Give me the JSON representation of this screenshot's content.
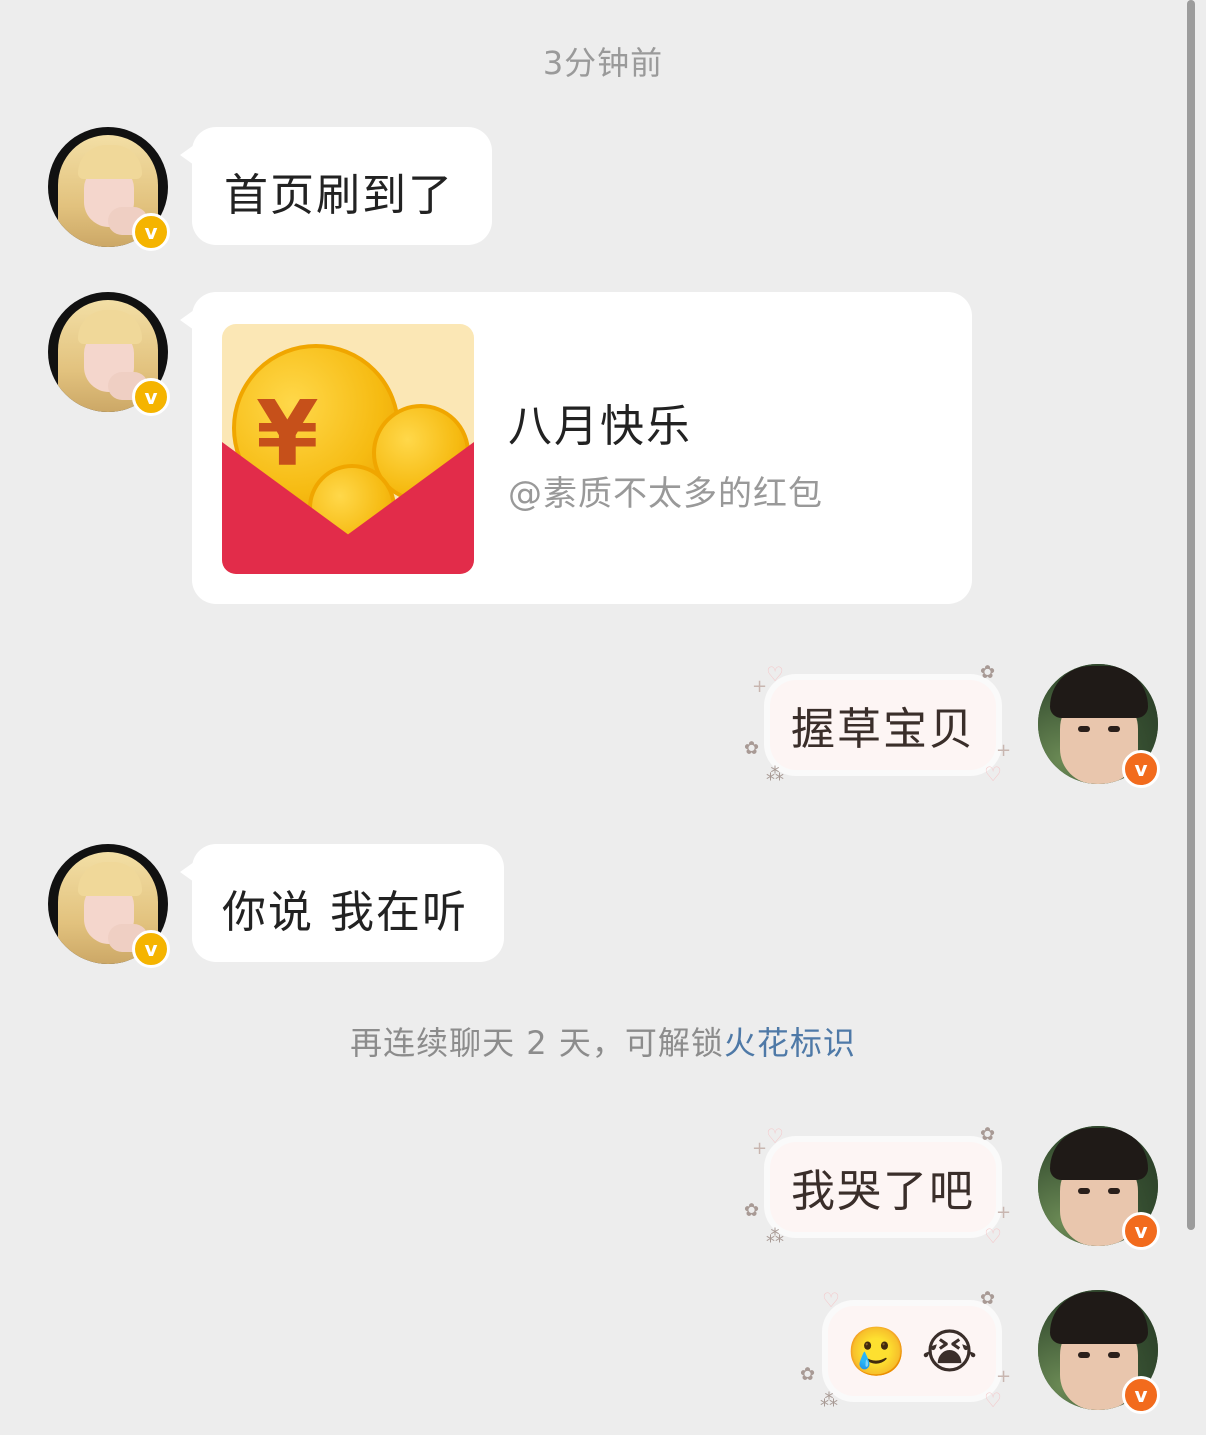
{
  "header": {
    "timestamp": "3分钟前"
  },
  "messages": [
    {
      "side": "left",
      "type": "text",
      "text": "首页刷到了"
    },
    {
      "side": "left",
      "type": "red-packet",
      "title": "八月快乐",
      "subtitle": "@素质不太多的红包"
    },
    {
      "side": "right",
      "type": "text",
      "text": "握草宝贝"
    },
    {
      "side": "left",
      "type": "text",
      "text": "你说 我在听"
    },
    {
      "side": "right",
      "type": "text",
      "text": "我哭了吧"
    },
    {
      "side": "right",
      "type": "emoji",
      "text": "🥲 😭"
    }
  ],
  "system_notice": {
    "prefix": "再连续聊天 2 天，可解锁",
    "link": "火花标识"
  },
  "badges": {
    "verified_mark": "v"
  },
  "colors": {
    "background": "#ededed",
    "left_bubble": "#ffffff",
    "right_bubble": "#fdf5f4",
    "link": "#4e79a7",
    "badge_gold": "#f5b400",
    "badge_orange": "#f26b1d",
    "red_packet": "#e22c4a"
  }
}
